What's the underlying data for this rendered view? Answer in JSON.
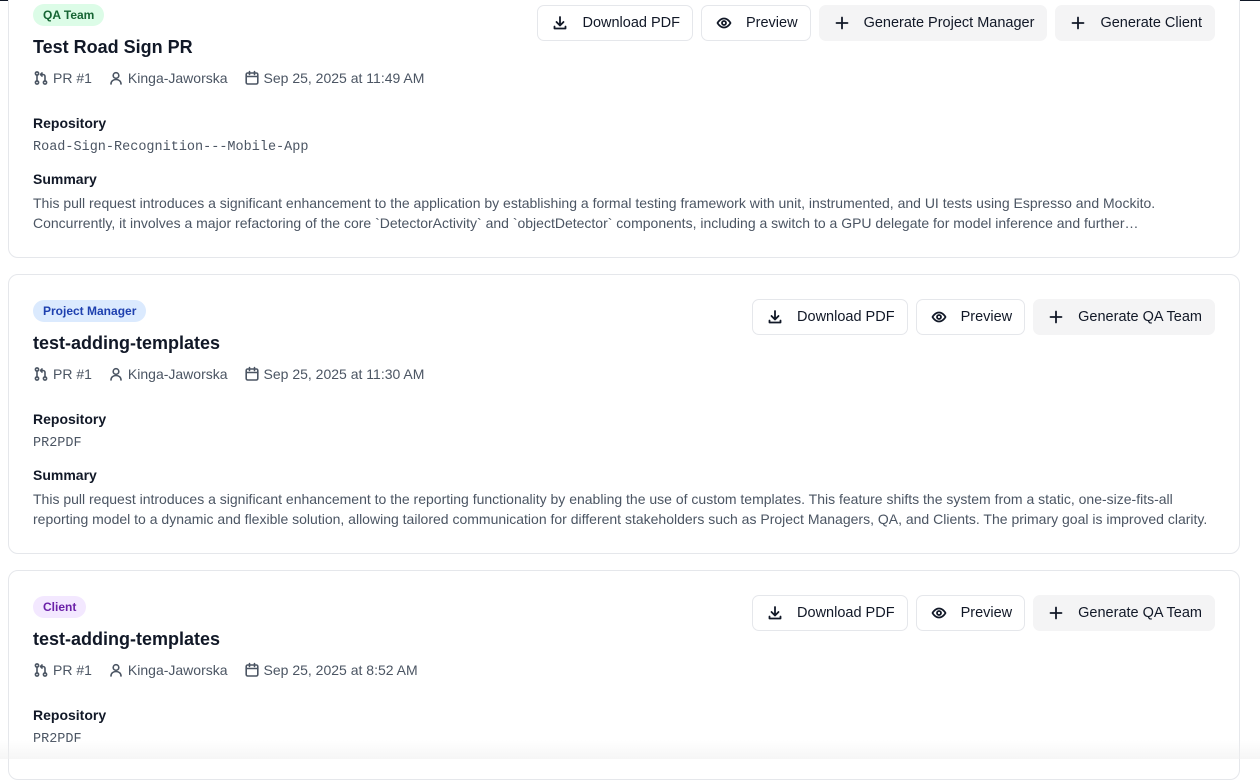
{
  "cards": [
    {
      "badge": "QA Team",
      "title": "Test Road Sign PR",
      "pr": "PR #1",
      "author": "Kinga-Jaworska",
      "date": "Sep 25, 2025 at 11:49 AM",
      "repository_label": "Repository",
      "repository": "Road-Sign-Recognition---Mobile-App",
      "summary_label": "Summary",
      "summary": "This pull request introduces a significant enhancement to the application by establishing a formal testing framework with unit, instrumented, and UI tests using Espresso and Mockito. Concurrently, it involves a major refactoring of the core `DetectorActivity` and `objectDetector` components, including a switch to a GPU delegate for model inference and further optimizations.",
      "buttons": {
        "download": "Download PDF",
        "preview": "Preview",
        "generate_1": "Generate Project Manager",
        "generate_2": "Generate Client"
      }
    },
    {
      "badge": "Project Manager",
      "title": "test-adding-templates",
      "pr": "PR #1",
      "author": "Kinga-Jaworska",
      "date": "Sep 25, 2025 at 11:30 AM",
      "repository_label": "Repository",
      "repository": "PR2PDF",
      "summary_label": "Summary",
      "summary": "This pull request introduces a significant enhancement to the reporting functionality by enabling the use of custom templates. This feature shifts the system from a static, one-size-fits-all reporting model to a dynamic and flexible solution, allowing tailored communication for different stakeholders such as Project Managers, QA, and Clients. The primary goal is improved clarity.",
      "buttons": {
        "download": "Download PDF",
        "preview": "Preview",
        "generate_1": "Generate QA Team"
      }
    },
    {
      "badge": "Client",
      "title": "test-adding-templates",
      "pr": "PR #1",
      "author": "Kinga-Jaworska",
      "date": "Sep 25, 2025 at 8:52 AM",
      "repository_label": "Repository",
      "repository": "PR2PDF",
      "buttons": {
        "download": "Download PDF",
        "preview": "Preview",
        "generate_1": "Generate QA Team"
      }
    }
  ]
}
